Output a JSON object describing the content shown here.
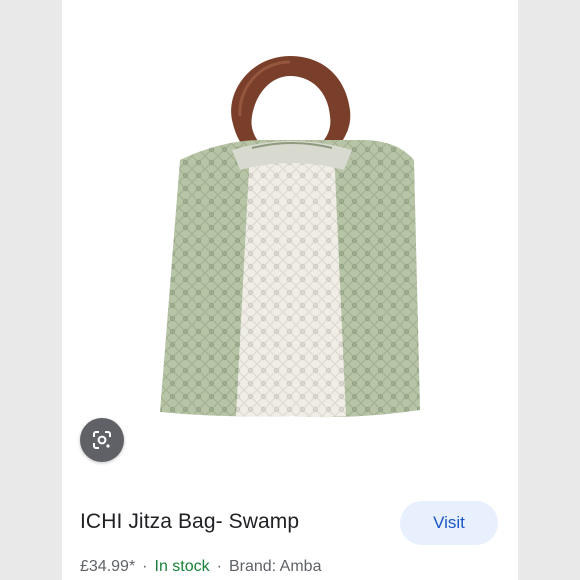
{
  "product": {
    "title": "ICHI Jitza Bag- Swamp",
    "price": "£34.99*",
    "stock": "In stock",
    "brand": "Brand: Amba",
    "separator": "·",
    "visit_label": "Visit"
  },
  "icons": {
    "lens": "google-lens-icon"
  },
  "colors": {
    "background": "#e9e9ea",
    "stock_green": "#188038",
    "visit_bg": "#e8f0fe",
    "visit_text": "#1a56c4",
    "bag_green": "#b9c6a8",
    "bag_white": "#f2efe9",
    "handle_wood": "#7a3f2a"
  }
}
